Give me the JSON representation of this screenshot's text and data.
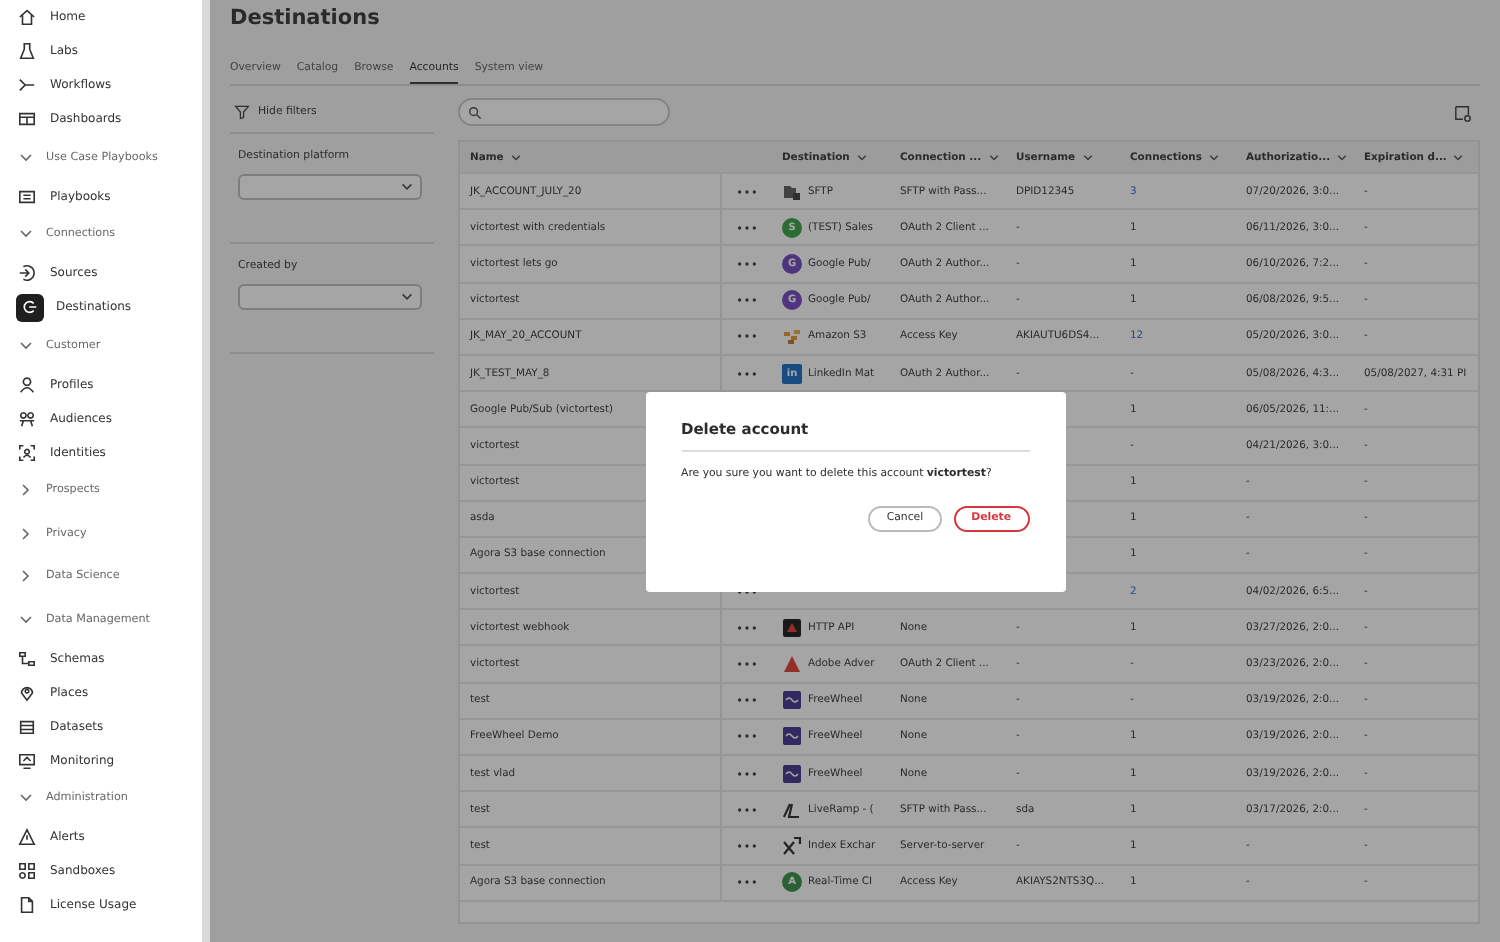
{
  "sidebar": {
    "items": [
      {
        "kind": "item",
        "label": "Home",
        "selected": false
      },
      {
        "kind": "item",
        "label": "Labs",
        "selected": false
      },
      {
        "kind": "item",
        "label": "Workflows",
        "selected": false
      },
      {
        "kind": "item",
        "label": "Dashboards",
        "selected": false
      },
      {
        "kind": "section",
        "label": "Use Case Playbooks",
        "expanded": true
      },
      {
        "kind": "item",
        "label": "Playbooks",
        "selected": false
      },
      {
        "kind": "section",
        "label": "Connections",
        "expanded": true
      },
      {
        "kind": "item",
        "label": "Sources",
        "selected": false
      },
      {
        "kind": "item",
        "label": "Destinations",
        "selected": true
      },
      {
        "kind": "section",
        "label": "Customer",
        "expanded": true
      },
      {
        "kind": "item",
        "label": "Profiles",
        "selected": false
      },
      {
        "kind": "item",
        "label": "Audiences",
        "selected": false
      },
      {
        "kind": "item",
        "label": "Identities",
        "selected": false
      },
      {
        "kind": "section",
        "label": "Prospects",
        "expanded": false
      },
      {
        "kind": "section",
        "label": "Privacy",
        "expanded": false
      },
      {
        "kind": "section",
        "label": "Data Science",
        "expanded": false
      },
      {
        "kind": "section",
        "label": "Data Management",
        "expanded": true
      },
      {
        "kind": "item",
        "label": "Schemas",
        "selected": false
      },
      {
        "kind": "item",
        "label": "Places",
        "selected": false
      },
      {
        "kind": "item",
        "label": "Datasets",
        "selected": false
      },
      {
        "kind": "item",
        "label": "Monitoring",
        "selected": false
      },
      {
        "kind": "section",
        "label": "Administration",
        "expanded": true
      },
      {
        "kind": "item",
        "label": "Alerts",
        "selected": false
      },
      {
        "kind": "item",
        "label": "Sandboxes",
        "selected": false
      },
      {
        "kind": "item",
        "label": "License Usage",
        "selected": false
      }
    ]
  },
  "page": {
    "title": "Destinations",
    "tabs": [
      {
        "label": "Overview",
        "selected": false
      },
      {
        "label": "Catalog",
        "selected": false
      },
      {
        "label": "Browse",
        "selected": false
      },
      {
        "label": "Accounts",
        "selected": true
      },
      {
        "label": "System view",
        "selected": false
      }
    ]
  },
  "filters": {
    "toggle": "Hide filters",
    "groups": [
      {
        "label": "Destination platform"
      },
      {
        "label": "Created by"
      }
    ]
  },
  "table": {
    "columns": [
      "Name",
      "Destination",
      "Connection ...",
      "Username",
      "Connections",
      "Authorizatio...",
      "Expiration d..."
    ],
    "rows": [
      {
        "name": "JK_ACCOUNT_JULY_20",
        "kind": "sftp",
        "destination": "SFTP",
        "connection": "SFTP with Pass...",
        "username": "DPID12345",
        "connections": "3",
        "linked": true,
        "authorization": "07/20/2026, 3:0...",
        "expiration": "-"
      },
      {
        "name": "victortest with credentials",
        "kind": "salesforce",
        "badge": "S",
        "destination": "(TEST) Sales",
        "connection": "OAuth 2 Client ...",
        "username": "-",
        "connections": "1",
        "linked": false,
        "authorization": "06/11/2026, 3:0...",
        "expiration": "-"
      },
      {
        "name": "victortest lets go",
        "kind": "google",
        "badge": "G",
        "destination": "Google Pub/",
        "connection": "OAuth 2 Author...",
        "username": "-",
        "connections": "1",
        "linked": false,
        "authorization": "06/10/2026, 7:2...",
        "expiration": "-"
      },
      {
        "name": "victortest",
        "kind": "google",
        "badge": "G",
        "destination": "Google Pub/",
        "connection": "OAuth 2 Author...",
        "username": "-",
        "connections": "1",
        "linked": false,
        "authorization": "06/08/2026, 9:5...",
        "expiration": "-"
      },
      {
        "name": "JK_MAY_20_ACCOUNT",
        "kind": "amazon",
        "destination": "Amazon S3",
        "connection": "Access Key",
        "username": "AKIAUTU6DS4...",
        "connections": "12",
        "linked": true,
        "authorization": "05/20/2026, 3:0...",
        "expiration": "-"
      },
      {
        "name": "JK_TEST_MAY_8",
        "kind": "linkedin",
        "badge": "in",
        "destination": "LinkedIn Mat",
        "connection": "OAuth 2 Author...",
        "username": "-",
        "connections": "-",
        "linked": false,
        "authorization": "05/08/2026, 4:3...",
        "expiration": "05/08/2027, 4:31 PI"
      },
      {
        "name": "Google Pub/Sub (victortest)",
        "connections": "1",
        "linked": false,
        "authorization": "06/05/2026, 11:...",
        "expiration": "-"
      },
      {
        "name": "victortest",
        "connections": "-",
        "linked": false,
        "authorization": "04/21/2026, 3:0...",
        "expiration": "-"
      },
      {
        "name": "victortest",
        "connections": "1",
        "linked": false,
        "authorization": "-",
        "expiration": "-"
      },
      {
        "name": "asda",
        "connections": "1",
        "linked": false,
        "authorization": "-",
        "expiration": "-"
      },
      {
        "name": "Agora S3 base connection",
        "connections": "1",
        "linked": false,
        "authorization": "-",
        "expiration": "-"
      },
      {
        "name": "victortest",
        "connections": "2",
        "linked": true,
        "authorization": "04/02/2026, 6:5...",
        "expiration": "-"
      },
      {
        "name": "victortest webhook",
        "kind": "http",
        "destination": "HTTP API",
        "connection": "None",
        "username": "-",
        "connections": "1",
        "linked": false,
        "authorization": "03/27/2026, 2:0...",
        "expiration": "-"
      },
      {
        "name": "victortest",
        "kind": "adobe",
        "destination": "Adobe Adver",
        "connection": "OAuth 2 Client ...",
        "username": "-",
        "connections": "-",
        "linked": false,
        "authorization": "03/23/2026, 2:0...",
        "expiration": "-"
      },
      {
        "name": "test",
        "kind": "freewheel",
        "destination": "FreeWheel",
        "connection": "None",
        "username": "-",
        "connections": "-",
        "linked": false,
        "authorization": "03/19/2026, 2:0...",
        "expiration": "-"
      },
      {
        "name": "FreeWheel Demo",
        "kind": "freewheel",
        "destination": "FreeWheel",
        "connection": "None",
        "username": "-",
        "connections": "1",
        "linked": false,
        "authorization": "03/19/2026, 2:0...",
        "expiration": "-"
      },
      {
        "name": "test vlad",
        "kind": "freewheel",
        "destination": "FreeWheel",
        "connection": "None",
        "username": "-",
        "connections": "1",
        "linked": false,
        "authorization": "03/19/2026, 2:0...",
        "expiration": "-"
      },
      {
        "name": "test",
        "kind": "liveramp",
        "destination": "LiveRamp - (",
        "connection": "SFTP with Pass...",
        "username": "sda",
        "connections": "1",
        "linked": false,
        "authorization": "03/17/2026, 2:0...",
        "expiration": "-"
      },
      {
        "name": "test",
        "kind": "index",
        "destination": "Index Exchar",
        "connection": "Server-to-server",
        "username": "-",
        "connections": "1",
        "linked": false,
        "authorization": "-",
        "expiration": "-"
      },
      {
        "name": "Agora S3 base connection",
        "kind": "realtime",
        "badge": "A",
        "destination": "Real-Time CI",
        "connection": "Access Key",
        "username": "AKIAYS2NTS3Q...",
        "connections": "1",
        "linked": false,
        "authorization": "-",
        "expiration": "-"
      }
    ]
  },
  "dialog": {
    "title": "Delete account",
    "message": "Are you sure you want to delete this account **victortest**?",
    "buttons": [
      {
        "label": "Cancel",
        "kind": "secondary"
      },
      {
        "label": "Delete",
        "kind": "destructive"
      }
    ]
  }
}
